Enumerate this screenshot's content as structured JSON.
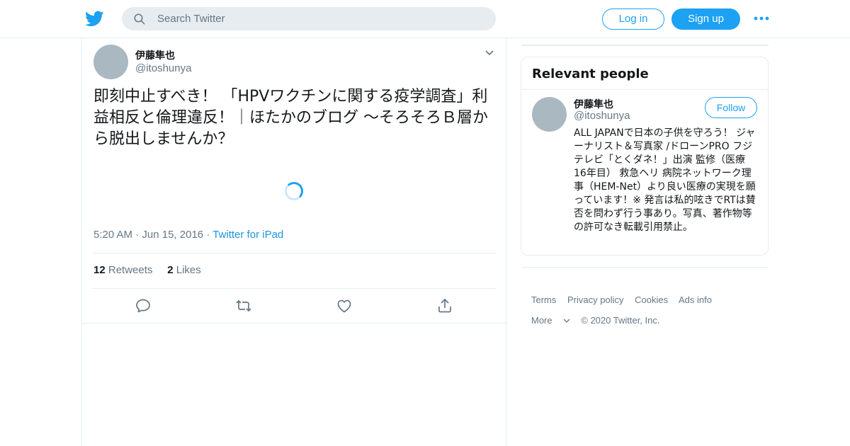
{
  "header": {
    "logo_icon": "twitter-bird-icon",
    "search_placeholder": "Search Twitter",
    "login_label": "Log in",
    "signup_label": "Sign up",
    "more_icon": "more-dots-icon"
  },
  "tweet": {
    "author_name": "伊藤隼也",
    "author_handle": "@itoshunya",
    "text": "即刻中止すべき！ 「HPVワクチンに関する疫学調査」利益相反と倫理違反！｜ほたかのブログ ～そろそろＢ層から脱出しませんか？",
    "time": "5:20 AM",
    "date": "Jun 15, 2016",
    "source": "Twitter for iPad",
    "retweet_count": "12",
    "retweet_label": "Retweets",
    "like_count": "2",
    "like_label": "Likes",
    "actions": [
      "reply-icon",
      "retweet-icon",
      "like-icon",
      "share-icon"
    ]
  },
  "relevant_people": {
    "title": "Relevant people",
    "person": {
      "name": "伊藤隼也",
      "handle": "@itoshunya",
      "follow_label": "Follow",
      "bio": "ALL JAPANで日本の子供を守ろう！ ジャーナリスト＆写真家 /ドローンPRO フジテレビ「とくダネ！」出演 監修（医療 16年目） 救急ヘリ 病院ネットワーク理事（HEM-Net）より良い医療の実現を願っています！※ 発言は私的呟きでRTは賛否を問わず行う事あり。写真、著作物等の許可なき転載引用禁止。"
    }
  },
  "footer": {
    "links": [
      "Terms",
      "Privacy policy",
      "Cookies",
      "Ads info"
    ],
    "more_label": "More",
    "copyright": "© 2020 Twitter, Inc."
  },
  "colors": {
    "accent": "#1da1f2",
    "link": "#1b95e0",
    "muted": "#657786",
    "border": "#e6ecf0"
  }
}
